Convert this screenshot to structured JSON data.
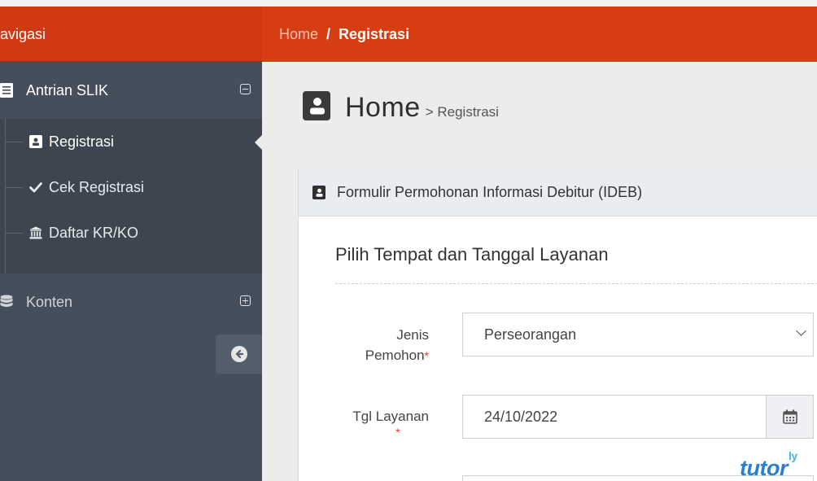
{
  "sidebar": {
    "header": "avigasi",
    "groups": [
      {
        "label": "Antrian SLIK",
        "items": [
          {
            "label": "Registrasi",
            "icon": "contact-card-icon",
            "active": true
          },
          {
            "label": "Cek Registrasi",
            "icon": "check-icon",
            "active": false
          },
          {
            "label": "Daftar KR/KO",
            "icon": "bank-icon",
            "active": false
          }
        ]
      },
      {
        "label": "Konten",
        "icon": "database-icon"
      }
    ]
  },
  "breadcrumb": {
    "home": "Home",
    "separator": "/",
    "current": "Registrasi"
  },
  "page_title": {
    "main": "Home",
    "sub": "> Registrasi"
  },
  "panel": {
    "title": "Formulir Permohonan Informasi Debitur (IDEB)",
    "section_title": "Pilih Tempat dan Tanggal Layanan",
    "fields": {
      "jenis_pemohon": {
        "label_line1": "Jenis",
        "label_line2": "Pemohon",
        "required_mark": "*",
        "value": "Perseorangan"
      },
      "tgl_layanan": {
        "label": "Tgl Layanan",
        "required_mark": "*",
        "value": "24/10/2022"
      }
    }
  },
  "watermark": {
    "text": "tutor",
    "sup": "ly"
  },
  "colors": {
    "accent": "#d73d12",
    "sidebar": "#454e5b",
    "panel_header": "#e9ecf1"
  }
}
